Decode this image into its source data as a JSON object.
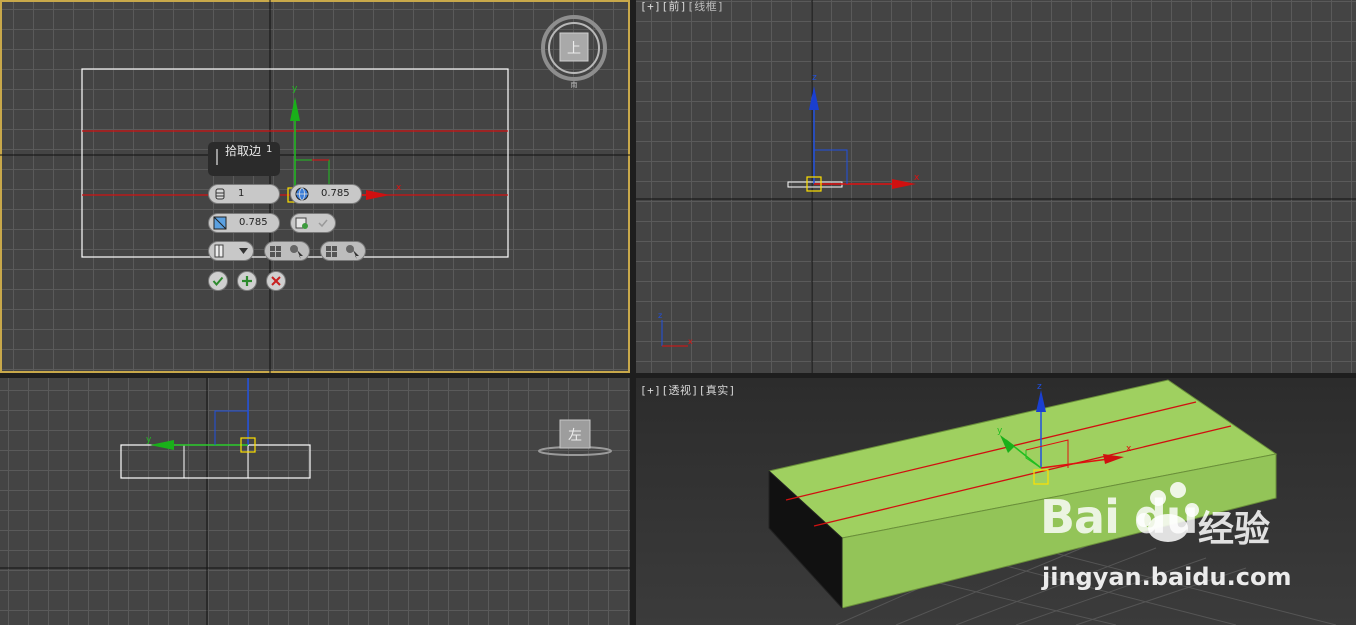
{
  "viewports": {
    "front": {
      "label_plus": "[+]",
      "label_view": "[前]",
      "label_shade": "[线框]"
    },
    "perspective": {
      "label_plus": "[+]",
      "label_view": "[透视]",
      "label_shade": "[真实]"
    }
  },
  "viewcube": {
    "top_face": "上",
    "left_face": "左",
    "top_bottom_label": "南"
  },
  "caddy": {
    "title": "拾取边",
    "title_num": "1",
    "segments_value": "1",
    "radius_value": "0.785",
    "slide_value": "0.785",
    "ok_icon": "check-icon",
    "apply_icon": "plus-icon",
    "cancel_icon": "close-icon"
  },
  "axes": {
    "x": "x",
    "y": "y",
    "z": "z"
  },
  "watermark": {
    "logo": "Bai du",
    "jingyan": "经验",
    "url": "jingyan.baidu.com"
  },
  "colors": {
    "grid_bg": "#444444",
    "active_border": "#c8a84a",
    "box_fill": "#9fd060",
    "edge_red": "#d01010"
  }
}
